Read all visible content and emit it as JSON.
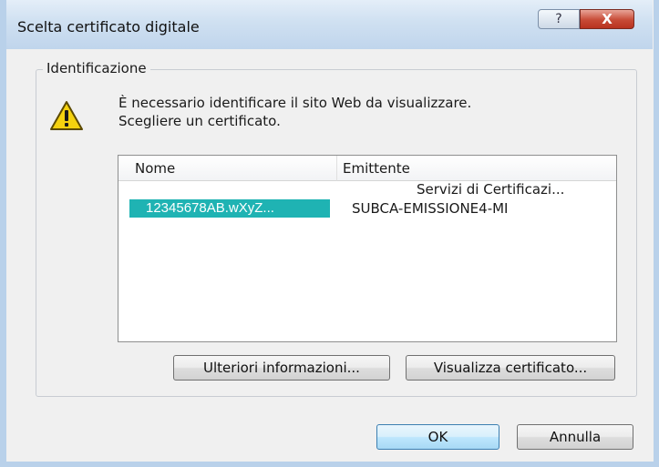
{
  "dialog": {
    "title": "Scelta certificato digitale",
    "help_label": "?",
    "close_label": "X"
  },
  "group": {
    "label": "Identificazione",
    "message_line1": "È necessario identificare il sito Web da visualizzare.",
    "message_line2": "Scegliere un certificato."
  },
  "list": {
    "columns": [
      "Nome",
      "Emittente"
    ],
    "rows": [
      {
        "nome": "",
        "emittente": "Servizi di Certificazi..."
      },
      {
        "nome": "12345678AB.wXyZ...",
        "emittente": "SUBCA-EMISSIONE4-MI"
      }
    ],
    "selected_color": "#1fb3b3"
  },
  "buttons": {
    "more_info": "Ulteriori informazioni...",
    "view_certificate": "Visualizza certificato...",
    "ok": "OK",
    "cancel": "Annulla"
  },
  "icons": {
    "warning": "warning-icon",
    "help": "help-icon",
    "close": "close-icon"
  }
}
